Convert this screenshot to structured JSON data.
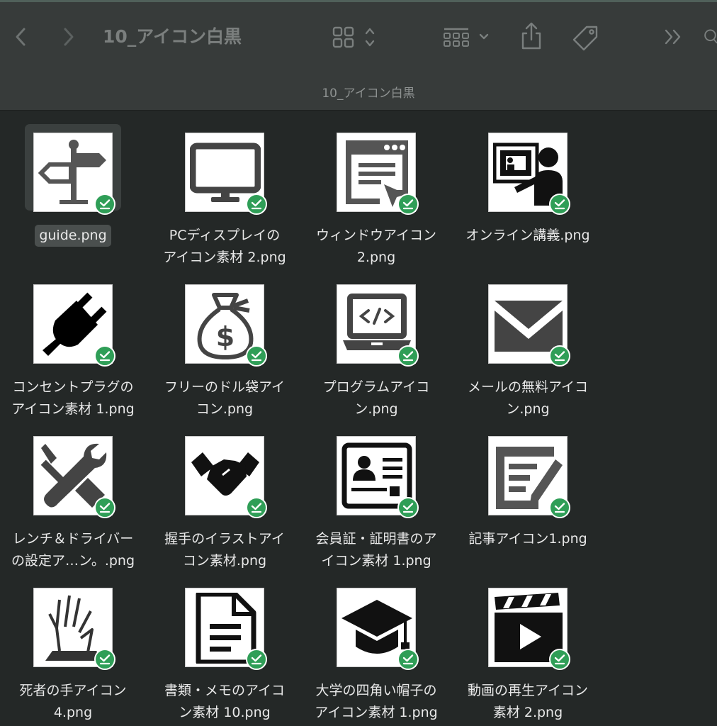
{
  "window": {
    "title": "10_アイコン白黒",
    "path_title": "10_アイコン白黒"
  },
  "toolbar": {
    "back_icon": "chevron-left-icon",
    "forward_icon": "chevron-right-icon",
    "view_icon": "grid-view-icon",
    "group_icon": "group-by-icon",
    "share_icon": "share-icon",
    "tag_icon": "tag-icon",
    "more_icon": "double-chevron-right-icon",
    "search_icon": "search-icon"
  },
  "colors": {
    "toolbar_bg": "#373b3a",
    "content_bg": "#242827",
    "badge_green": "#2f9e57",
    "selection_bg": "#3b403f"
  },
  "files": [
    {
      "line1": "guide.png",
      "line2": "",
      "icon": "signpost-icon",
      "selected": true
    },
    {
      "line1": "PCディスプレイの",
      "line2": "アイコン素材 2.png",
      "icon": "monitor-icon"
    },
    {
      "line1": "ウィンドウアイコン",
      "line2": "2.png",
      "icon": "browser-window-icon"
    },
    {
      "line1": "オンライン講義.png",
      "line2": "",
      "icon": "online-lecture-icon"
    },
    {
      "line1": "コンセントプラグの",
      "line2": "アイコン素材 1.png",
      "icon": "power-plug-icon"
    },
    {
      "line1": "フリーのドル袋アイ",
      "line2": "コン.png",
      "icon": "money-bag-icon"
    },
    {
      "line1": "プログラムアイコ",
      "line2": "ン.png",
      "icon": "laptop-code-icon"
    },
    {
      "line1": "メールの無料アイコ",
      "line2": "ン.png",
      "icon": "mail-envelope-icon"
    },
    {
      "line1": "レンチ＆ドライバー",
      "line2": "の設定ア…ン。.png",
      "icon": "wrench-screwdriver-icon"
    },
    {
      "line1": "握手のイラストアイ",
      "line2": "コン素材.png",
      "icon": "handshake-icon"
    },
    {
      "line1": "会員証・証明書のア",
      "line2": "イコン素材 1.png",
      "icon": "id-card-icon"
    },
    {
      "line1": "記事アイコン1.png",
      "line2": "",
      "icon": "article-pen-icon"
    },
    {
      "line1": "死者の手アイコン",
      "line2": "4.png",
      "icon": "zombie-hand-icon"
    },
    {
      "line1": "書類・メモのアイコ",
      "line2": "ン素材 10.png",
      "icon": "document-icon"
    },
    {
      "line1": "大学の四角い帽子の",
      "line2": "アイコン素材 1.png",
      "icon": "graduation-cap-icon"
    },
    {
      "line1": "動画の再生アイコン",
      "line2": "素材 2.png",
      "icon": "video-play-icon"
    }
  ]
}
